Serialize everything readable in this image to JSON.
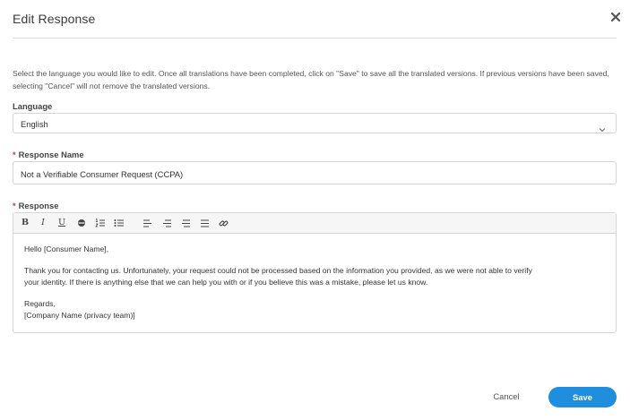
{
  "modal": {
    "title": "Edit Response",
    "close_icon": "close-icon",
    "intro_text": "Select the language you would like to edit. Once all translations have been completed, click on \"Save\" to save all the translated versions. If previous versions have been saved, selecting \"Cancel\" will not remove the translated versions."
  },
  "language": {
    "label": "Language",
    "selected": "English",
    "icon": "chevron-down-icon"
  },
  "response_name": {
    "required_marker": "*",
    "label": "Response Name",
    "value": "Not a Verifiable Consumer Request (CCPA)"
  },
  "response": {
    "required_marker": "*",
    "label": "Response",
    "toolbar": {
      "bold": "B",
      "italic": "I",
      "underline": "U",
      "icons": [
        "bold-icon",
        "italic-icon",
        "underline-icon",
        "strikethrough-icon",
        "ordered-list-icon",
        "bullet-list-icon",
        "align-left-icon",
        "align-center-icon",
        "align-right-icon",
        "align-justify-icon",
        "link-icon"
      ]
    },
    "body": {
      "greeting": "Hello [Consumer Name],",
      "para1_line1": "Thank you for contacting us. Unfortunately, your request could not be processed based on the information you provided, as we were not able to verify",
      "para1_line2": "your identity. If there is anything else that we can help you with or if you believe this was a mistake, please let us know.",
      "sign_off": "Regards,",
      "signature": "[Company Name (privacy team)]"
    }
  },
  "footer": {
    "cancel_label": "Cancel",
    "save_label": "Save",
    "save_color": "#1f8ede"
  }
}
